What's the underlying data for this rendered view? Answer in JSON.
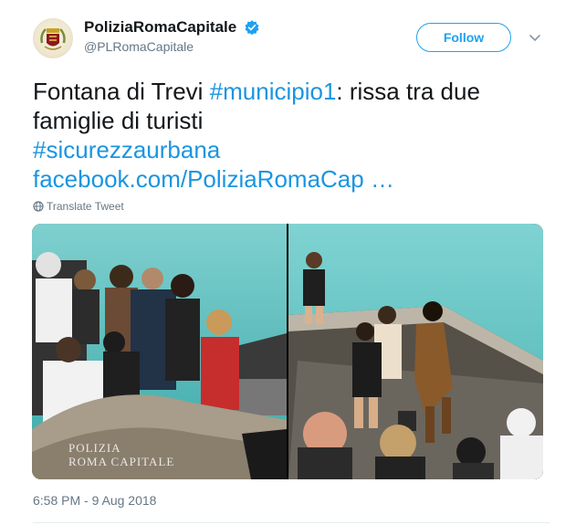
{
  "author": {
    "display_name": "PoliziaRomaCapitale",
    "handle": "@PLRomaCapitale",
    "verified": true
  },
  "actions": {
    "follow_label": "Follow"
  },
  "tweet": {
    "text_before": "Fontana di Trevi ",
    "hashtag_1": "#municipio1",
    "text_after": ": rissa tra due famiglie di turisti",
    "hashtag_2": "#sicurezzaurbana",
    "link": "facebook.com/PoliziaRomaCap …",
    "translate_label": "Translate Tweet",
    "timestamp": "6:58 PM - 9 Aug 2018"
  },
  "media": {
    "watermark_line1": "POLIZIA",
    "watermark_line2": "ROMA CAPITALE"
  },
  "colors": {
    "link": "#1b95e0",
    "follow_border": "#1da1f2",
    "verified": "#1da1f2",
    "secondary_text": "#657786"
  }
}
